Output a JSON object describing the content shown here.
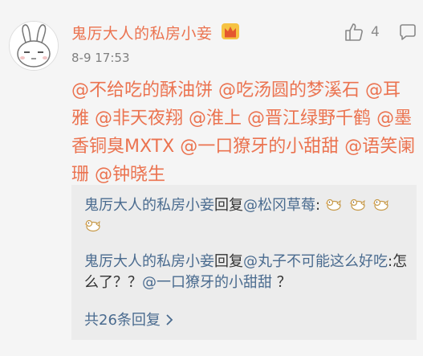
{
  "comment": {
    "username": "鬼厉大人的私房小妾",
    "timestamp": "8-9 17:53",
    "like_count": "4",
    "mentions": [
      "@不给吃的酥油饼",
      "@吃汤圆的梦溪石",
      "@耳雅",
      "@非天夜翔",
      "@淮上",
      "@晋江绿野千鹤",
      "@墨香铜臭MXTX",
      "@一口獠牙的小甜甜",
      "@语笑阑珊",
      "@钟晓生"
    ]
  },
  "replies": [
    {
      "author": "鬼厉大人的私房小妾",
      "verb": "回复",
      "target": "@松冈草莓",
      "text": ":"
    },
    {
      "author": "鬼厉大人的私房小妾",
      "verb": "回复",
      "target": "@丸子不可能这么好吃",
      "text_before": ":怎么了？？",
      "mention": "@一口獠牙的小甜甜",
      "text_after": " ？"
    }
  ],
  "more_replies_label": "共26条回复",
  "icons": {
    "avatar": "rabbit-avatar",
    "badge": "crown-icon",
    "like": "thumbs-up-icon",
    "more": "comment-icon",
    "emoji": "chick-emoji",
    "chevron": "chevron-right-icon"
  },
  "colors": {
    "username": "#eb7350",
    "link": "#4a6b8f",
    "meta": "#808080"
  }
}
